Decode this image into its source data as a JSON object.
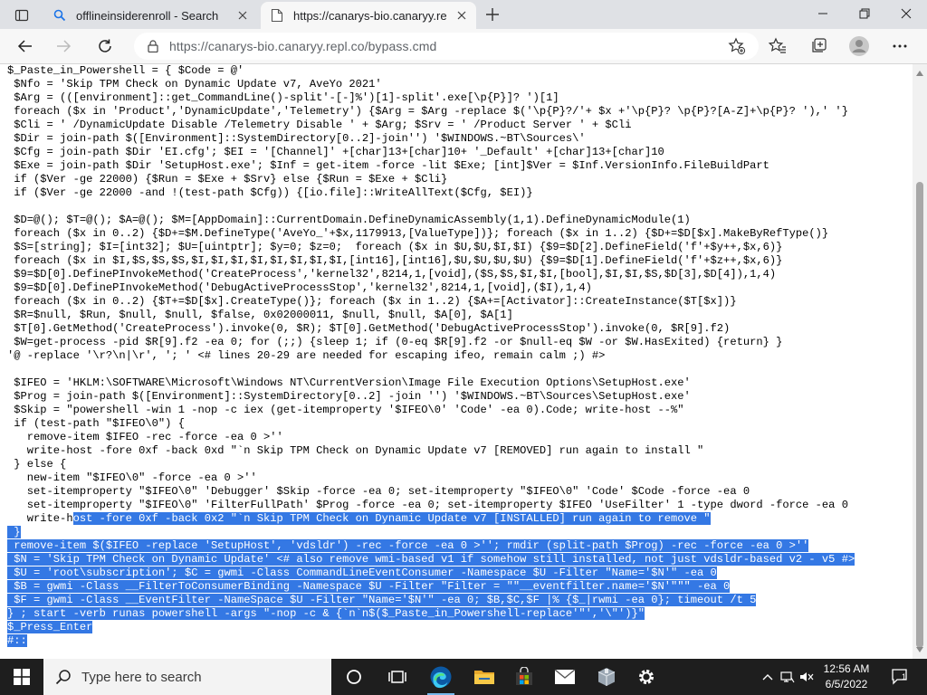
{
  "browser": {
    "tabs": [
      {
        "title": "offlineinsiderenroll - Search",
        "active": false,
        "favicon": "search-icon"
      },
      {
        "title": "https://canarys-bio.canaryy.repl.c",
        "active": true,
        "favicon": "page-icon"
      }
    ],
    "address": {
      "url": "https://canarys-bio.canaryy.repl.co/bypass.cmd"
    },
    "accent": "#3478e4"
  },
  "document": {
    "plain": [
      "$_Paste_in_Powershell = { $Code = @'",
      " $Nfo = 'Skip TPM Check on Dynamic Update v7, AveYo 2021'",
      " $Arg = (([environment]::get_CommandLine()-split'-[-]%')[1]-split'.exe[\\p{P}]? ')[1]",
      " foreach ($x in 'Product','DynamicUpdate','Telemetry') {$Arg = $Arg -replace $('\\p{P}?/'+ $x +'\\p{P}? \\p{P}?[A-Z]+\\p{P}? '),' '}",
      " $Cli = ' /DynamicUpdate Disable /Telemetry Disable ' + $Arg; $Srv = ' /Product Server ' + $Cli",
      " $Dir = join-path $([Environment]::SystemDirectory[0..2]-join'') '$WINDOWS.~BT\\Sources\\'",
      " $Cfg = join-path $Dir 'EI.cfg'; $EI = '[Channel]' +[char]13+[char]10+ '_Default' +[char]13+[char]10",
      " $Exe = join-path $Dir 'SetupHost.exe'; $Inf = get-item -force -lit $Exe; [int]$Ver = $Inf.VersionInfo.FileBuildPart",
      " if ($Ver -ge 22000) {$Run = $Exe + $Srv} else {$Run = $Exe + $Cli}",
      " if ($Ver -ge 22000 -and !(test-path $Cfg)) {[io.file]::WriteAllText($Cfg, $EI)}",
      "",
      " $D=@(); $T=@(); $A=@(); $M=[AppDomain]::CurrentDomain.DefineDynamicAssembly(1,1).DefineDynamicModule(1)",
      " foreach ($x in 0..2) {$D+=$M.DefineType('AveYo_'+$x,1179913,[ValueType])}; foreach ($x in 1..2) {$D+=$D[$x].MakeByRefType()}",
      " $S=[string]; $I=[int32]; $U=[uintptr]; $y=0; $z=0;  foreach ($x in $U,$U,$I,$I) {$9=$D[2].DefineField('f'+$y++,$x,6)}",
      " foreach ($x in $I,$S,$S,$S,$I,$I,$I,$I,$I,$I,$I,$I,[int16],[int16],$U,$U,$U,$U) {$9=$D[1].DefineField('f'+$z++,$x,6)}",
      " $9=$D[0].DefinePInvokeMethod('CreateProcess','kernel32',8214,1,[void],($S,$S,$I,$I,[bool],$I,$I,$S,$D[3],$D[4]),1,4)",
      " $9=$D[0].DefinePInvokeMethod('DebugActiveProcessStop','kernel32',8214,1,[void],($I),1,4)",
      " foreach ($x in 0..2) {$T+=$D[$x].CreateType()}; foreach ($x in 1..2) {$A+=[Activator]::CreateInstance($T[$x])}",
      " $R=$null, $Run, $null, $null, $false, 0x02000011, $null, $null, $A[0], $A[1]",
      " $T[0].GetMethod('CreateProcess').invoke(0, $R); $T[0].GetMethod('DebugActiveProcessStop').invoke(0, $R[9].f2)",
      " $W=get-process -pid $R[9].f2 -ea 0; for (;;) {sleep 1; if (0-eq $R[9].f2 -or $null-eq $W -or $W.HasExited) {return} }",
      "'@ -replace '\\r?\\n|\\r', '; ' <# lines 20-29 are needed for escaping ifeo, remain calm ;) #>",
      "",
      " $IFEO = 'HKLM:\\SOFTWARE\\Microsoft\\Windows NT\\CurrentVersion\\Image File Execution Options\\SetupHost.exe'",
      " $Prog = join-path $([Environment]::SystemDirectory[0..2] -join '') '$WINDOWS.~BT\\Sources\\SetupHost.exe'",
      " $Skip = \"powershell -win 1 -nop -c iex (get-itemproperty '$IFEO\\0' 'Code' -ea 0).Code; write-host --%\"",
      " if (test-path \"$IFEO\\0\") {",
      "   remove-item $IFEO -rec -force -ea 0 >''",
      "   write-host -fore 0xf -back 0xd \"`n Skip TPM Check on Dynamic Update v7 [REMOVED] run again to install \"",
      " } else {",
      "   new-item \"$IFEO\\0\" -force -ea 0 >''",
      "   set-itemproperty \"$IFEO\\0\" 'Debugger' $Skip -force -ea 0; set-itemproperty \"$IFEO\\0\" 'Code' $Code -force -ea 0",
      "   set-itemproperty \"$IFEO\\0\" 'FilterFullPath' $Prog -force -ea 0; set-itemproperty $IFEO 'UseFilter' 1 -type dword -force -ea 0"
    ],
    "split_line": {
      "before": "   write-h",
      "selected": "ost -fore 0xf -back 0x2 \"`n Skip TPM Check on Dynamic Update v7 [INSTALLED] run again to remove \""
    },
    "selected": [
      " }",
      " remove-item $($IFEO -replace 'SetupHost', 'vdsldr') -rec -force -ea 0 >''; rmdir (split-path $Prog) -rec -force -ea 0 >''",
      " $N = 'Skip TPM Check on Dynamic Update' <# also remove wmi-based v1 if somehow still installed, not just vdsldr-based v2 - v5 #>",
      " $U = 'root\\subscription'; $C = gwmi -Class CommandLineEventConsumer -Namespace $U -Filter \"Name='$N'\" -ea 0",
      " $B = gwmi -Class __FilterToConsumerBinding -Namespace $U -Filter \"Filter = \"\"__eventfilter.name='$N'\"\"\" -ea 0",
      " $F = gwmi -Class __EventFilter -NameSpace $U -Filter \"Name='$N'\" -ea 0; $B,$C,$F |% {$_|rwmi -ea 0}; timeout /t 5",
      "} ; start -verb runas powershell -args \"-nop -c & {`n`n$($_Paste_in_Powershell-replace'\"','\\\"')}\"",
      "$_Press_Enter",
      "#::"
    ]
  },
  "taskbar": {
    "search_placeholder": "Type here to search",
    "time": "12:56 AM",
    "date": "6/5/2022",
    "notification_count": "1",
    "pinned": [
      "task-view-icon",
      "edge-icon",
      "file-explorer-icon",
      "microsoft-store-icon",
      "mail-icon",
      "package-icon",
      "settings-icon"
    ]
  }
}
